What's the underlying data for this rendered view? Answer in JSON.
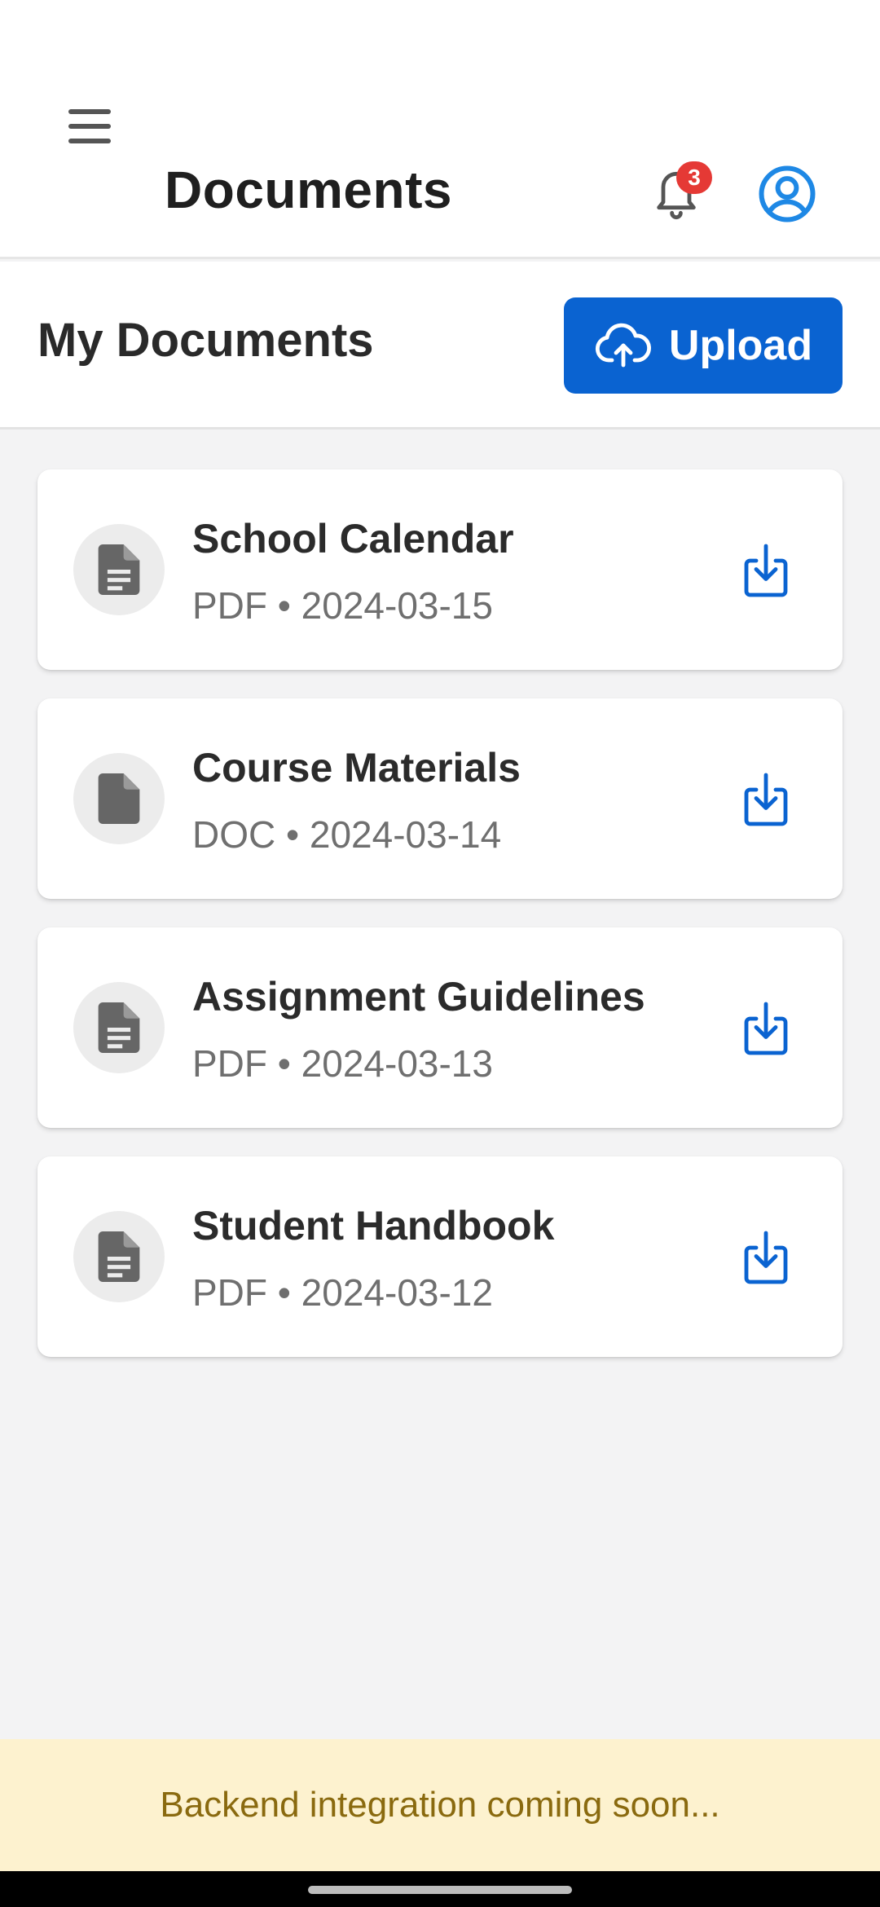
{
  "app_bar": {
    "title": "Documents",
    "notification_count": "3"
  },
  "section": {
    "title": "My Documents",
    "upload_label": "Upload"
  },
  "documents": [
    {
      "name": "School Calendar",
      "meta": "PDF • 2024-03-15",
      "icon": "file-text-icon"
    },
    {
      "name": "Course Materials",
      "meta": "DOC • 2024-03-14",
      "icon": "file-icon"
    },
    {
      "name": "Assignment Guidelines",
      "meta": "PDF • 2024-03-13",
      "icon": "file-text-icon"
    },
    {
      "name": "Student Handbook",
      "meta": "PDF • 2024-03-12",
      "icon": "file-text-icon"
    }
  ],
  "banner": {
    "text": "Backend integration coming soon..."
  },
  "colors": {
    "primary": "#0a63d1",
    "badge": "#e53935",
    "banner_bg": "#fdf2cf",
    "banner_text": "#8a6a0f"
  }
}
